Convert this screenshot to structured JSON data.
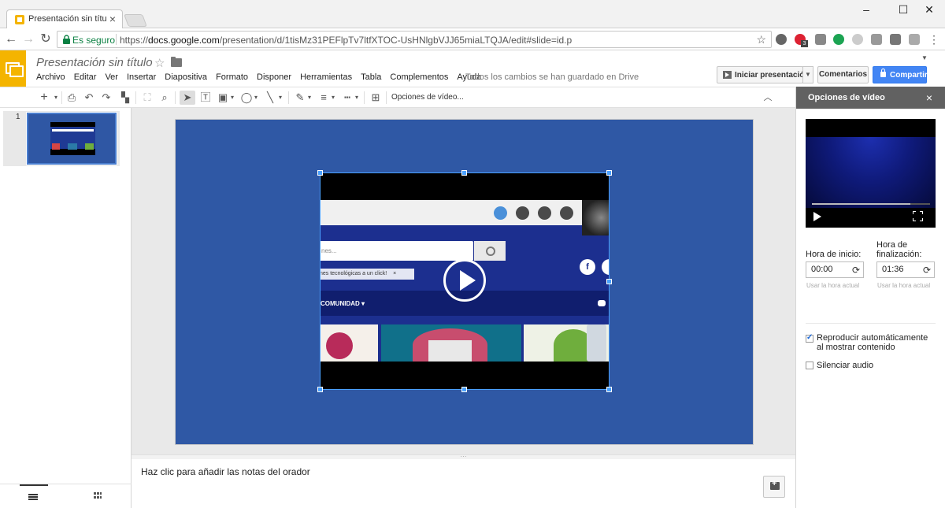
{
  "browser": {
    "tab_title": "Presentación sin título - Goo",
    "tab_close": "×",
    "window_minimize": "–",
    "window_maximize": "☐",
    "window_close": "✕",
    "security_label": "Es seguro",
    "url_scheme": "https://",
    "url_host": "docs.google.com",
    "url_path": "/presentation/d/1tisMz31PEFlpTv7ltfXTOC-UsHNlgbVJJ65miaLTQJA/edit#slide=id.p",
    "extension_badge": "3"
  },
  "doc": {
    "title": "Presentación sin título",
    "star": "☆",
    "menu": [
      "Archivo",
      "Editar",
      "Ver",
      "Insertar",
      "Diapositiva",
      "Formato",
      "Disponer",
      "Herramientas",
      "Tabla",
      "Complementos",
      "Ayuda"
    ],
    "save_status": "Todos los cambios se han guardado en Drive",
    "present_label": "Iniciar presentación",
    "comments_label": "Comentarios",
    "share_label": "Compartir"
  },
  "toolbar": {
    "video_options_label": "Opciones de vídeo..."
  },
  "filmstrip": {
    "slide_number": "1"
  },
  "video_preview": {
    "search_placeholder": "nes...",
    "tag_text": "nes tecnológicas a un click!",
    "tag_close": "×",
    "nav_label": "COMUNIDAD ▾",
    "fb_glyph": "f"
  },
  "notes": {
    "placeholder": "Haz clic para añadir las notas del orador"
  },
  "side_panel": {
    "title": "Opciones de vídeo",
    "close": "×",
    "start_label": "Hora de inicio:",
    "end_label": "Hora de finalización:",
    "start_value": "00:00",
    "end_value": "01:36",
    "reload_glyph": "⟳",
    "use_current_start": "Usar la hora actual",
    "use_current_end": "Usar la hora actual",
    "autoplay_label": "Reproducir automáticamente al mostrar contenido",
    "autoplay_checked": true,
    "mute_label": "Silenciar audio",
    "mute_checked": false
  },
  "colors": {
    "slides_brand": "#f4b400",
    "slide_background": "#2f58a5",
    "share_blue": "#4285f4",
    "selection_blue": "#4aa1ff",
    "panel_header": "#616161"
  }
}
